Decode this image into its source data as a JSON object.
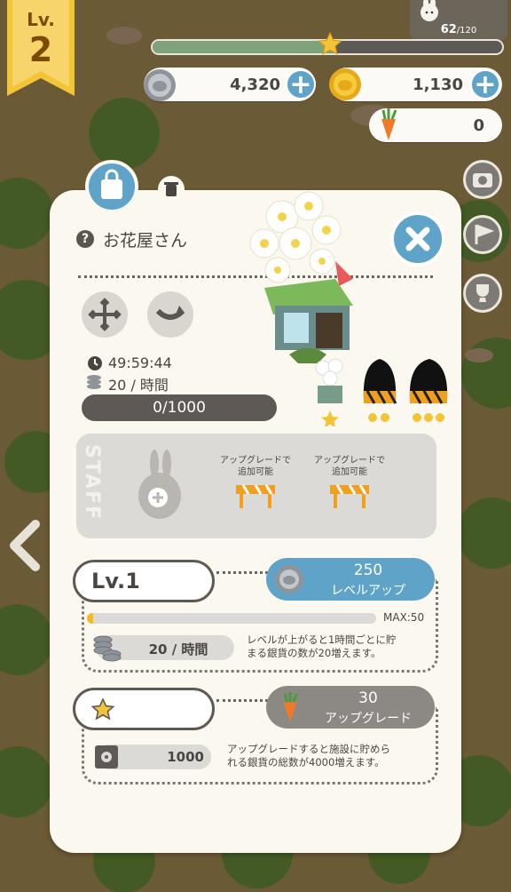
{
  "hud": {
    "level_label": "Lv.",
    "level_value": "2",
    "xp_current": "62",
    "xp_max": "/120",
    "xp_progress": 0.52,
    "silver": "4,320",
    "gold": "1,130",
    "carrots": "0",
    "plus": "+"
  },
  "panel": {
    "help": "?",
    "title": "お花屋さん",
    "timer": "49:59:44",
    "rate": "20 / 時間",
    "storage": "0/1000",
    "staff_label": "STAFF",
    "slot_text_1a": "アップグレードで",
    "slot_text_1b": "追加可能",
    "slot_text_2a": "アップグレードで",
    "slot_text_2b": "追加可能",
    "level_name": "Lv.1",
    "levelup_cost": "250",
    "levelup_label": "レベルアップ",
    "level_progress": 0.02,
    "max_label": "MAX:50",
    "level_rate": "20 / 時間",
    "level_desc_1": "レベルが上がると1時間ごとに貯",
    "level_desc_2": "まる銀貨の数が20増えます。",
    "upgrade_cost": "30",
    "upgrade_label": "アップグレード",
    "capacity": "1000",
    "upgrade_desc_1": "アップグレードすると施設に貯めら",
    "upgrade_desc_2": "れる銀貨の総数が4000増えます。"
  },
  "colors": {
    "accent_blue": "#5fa4c8",
    "dark_pill": "#5e5955",
    "upgrade_gray": "#8c8883",
    "gold_ribbon": "#f4c437"
  }
}
